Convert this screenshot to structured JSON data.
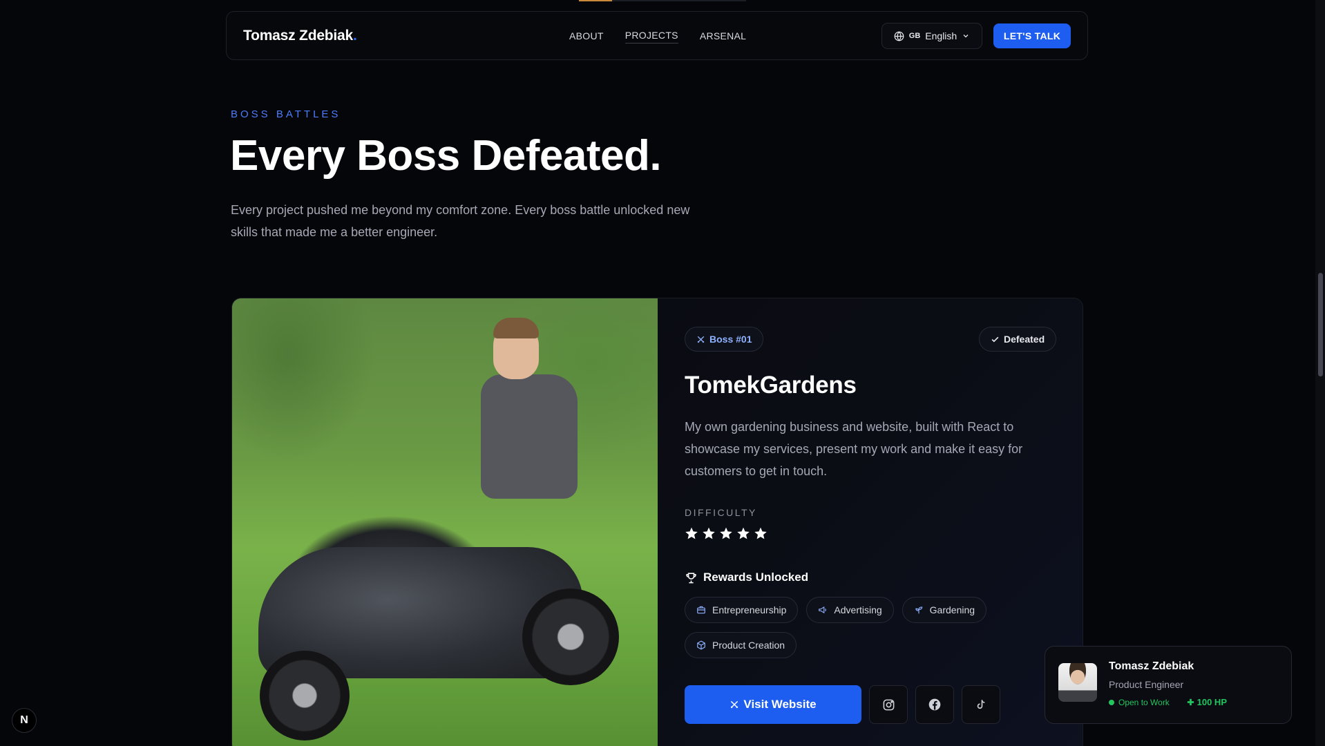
{
  "nav": {
    "brand": "Tomasz Zdebiak",
    "brand_dot": ".",
    "links": [
      "ABOUT",
      "PROJECTS",
      "ARSENAL"
    ],
    "active_link": "PROJECTS",
    "language_flag": "GB",
    "language": "English",
    "cta": "LET'S TALK"
  },
  "hero": {
    "eyebrow": "BOSS BATTLES",
    "title": "Every Boss Defeated.",
    "description": "Every project pushed me beyond my comfort zone. Every boss battle unlocked new skills that made me a better engineer."
  },
  "boss": {
    "badge": "Boss #01",
    "status": "Defeated",
    "name": "TomekGardens",
    "description": "My own gardening business and website, built with React to showcase my services, present my work and make it easy for customers to get in touch.",
    "difficulty_label": "DIFFICULTY",
    "difficulty_stars": 5,
    "difficulty_max": 5,
    "rewards_title": "Rewards Unlocked",
    "rewards": [
      {
        "label": "Entrepreneurship",
        "icon": "briefcase-icon"
      },
      {
        "label": "Advertising",
        "icon": "megaphone-icon"
      },
      {
        "label": "Gardening",
        "icon": "sprout-icon"
      },
      {
        "label": "Product Creation",
        "icon": "box-icon"
      }
    ],
    "visit_label": "Visit Website",
    "socials": [
      "instagram-icon",
      "facebook-icon",
      "tiktok-icon"
    ]
  },
  "profile": {
    "name": "Tomasz Zdebiak",
    "role": "Product Engineer",
    "status": "Open to Work",
    "hp": "100 HP"
  },
  "next_badge": "N",
  "colors": {
    "accent": "#1d5ef0",
    "eyebrow": "#4d7dff",
    "success": "#22c55e",
    "background": "#05060a"
  }
}
